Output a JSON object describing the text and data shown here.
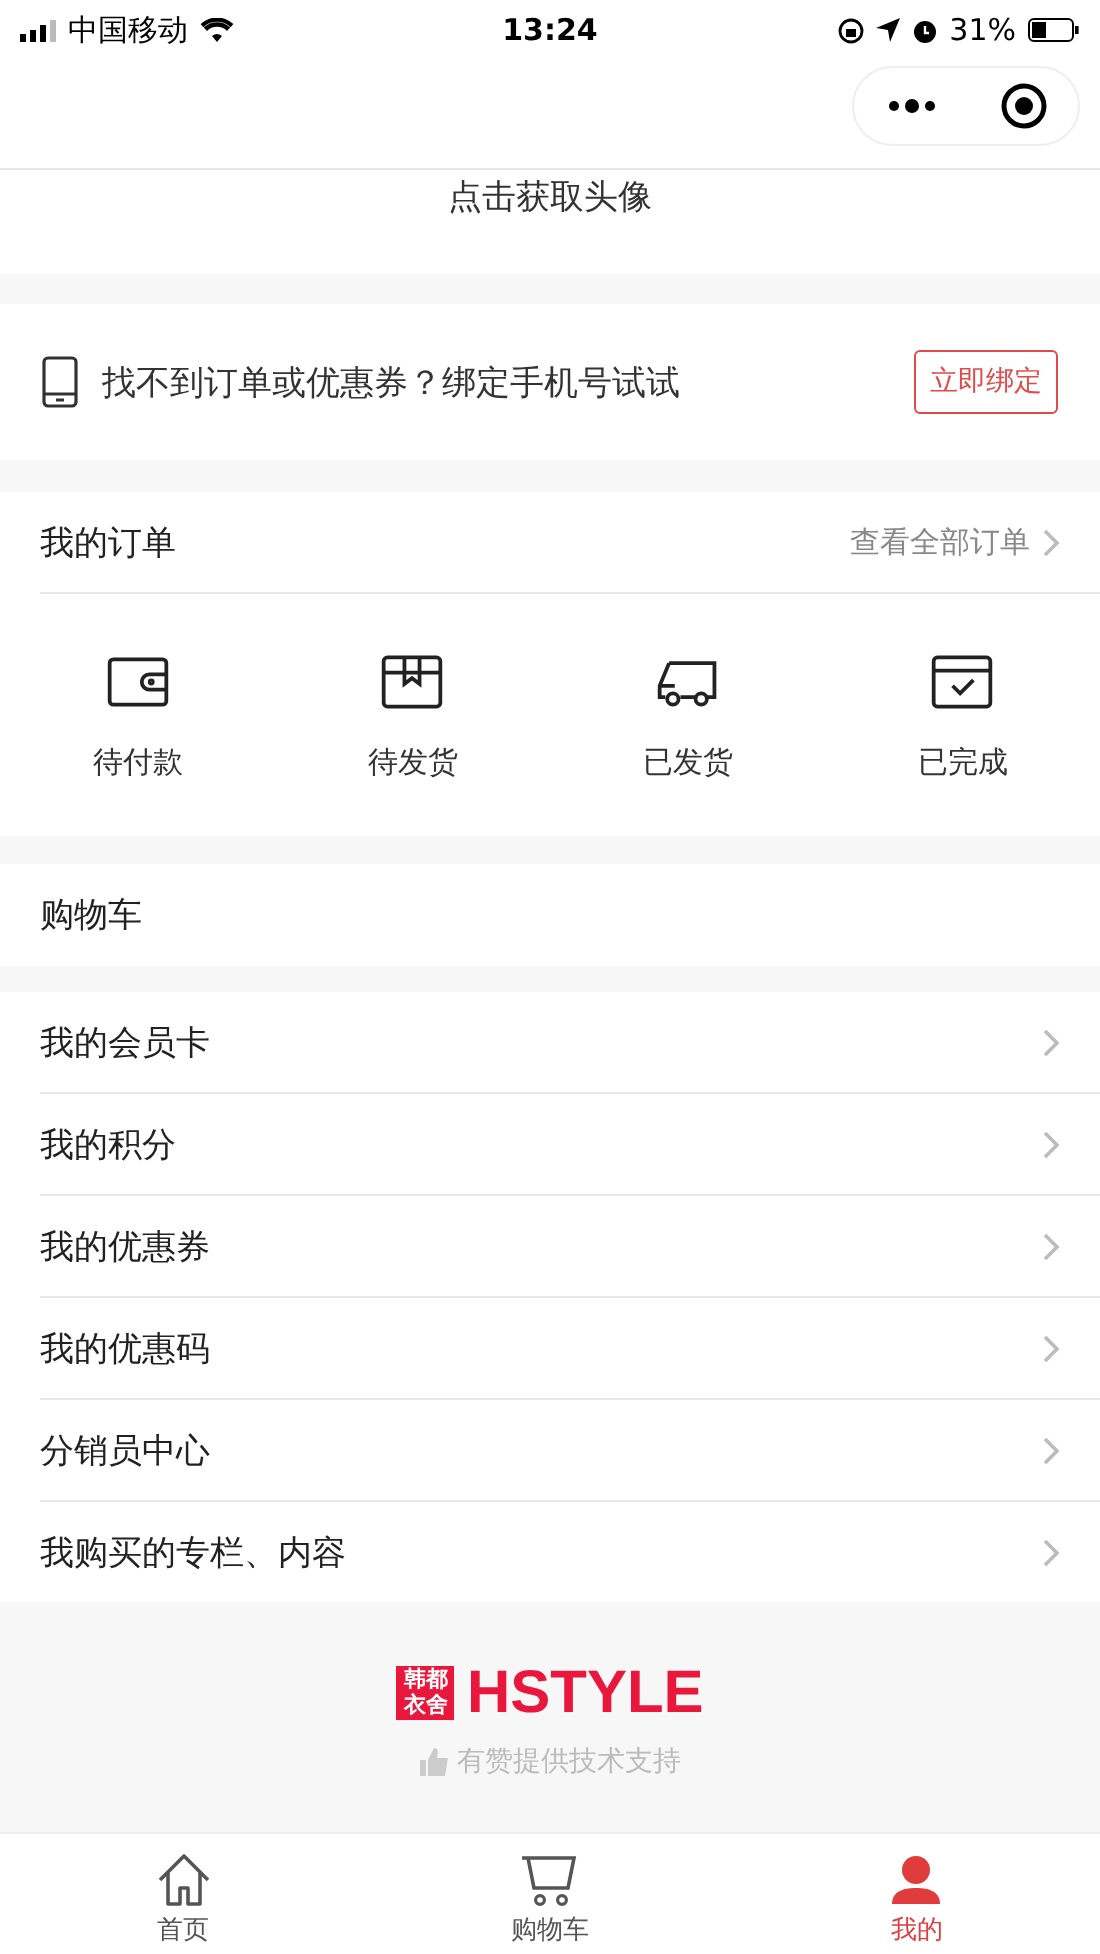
{
  "status_bar": {
    "carrier": "中国移动",
    "time": "13:24",
    "battery": "31%"
  },
  "avatar": {
    "prompt": "点击获取头像"
  },
  "bind_phone": {
    "message": "找不到订单或优惠券？绑定手机号试试",
    "button": "立即绑定"
  },
  "orders": {
    "title": "我的订单",
    "view_all": "查看全部订单",
    "items": [
      {
        "label": "待付款"
      },
      {
        "label": "待发货"
      },
      {
        "label": "已发货"
      },
      {
        "label": "已完成"
      }
    ]
  },
  "cart": {
    "title": "购物车"
  },
  "menu": [
    {
      "label": "我的会员卡"
    },
    {
      "label": "我的积分"
    },
    {
      "label": "我的优惠券"
    },
    {
      "label": "我的优惠码"
    },
    {
      "label": "分销员中心"
    },
    {
      "label": "我购买的专栏、内容"
    }
  ],
  "footer": {
    "logo_mark": "韩都衣舍",
    "logo_text": "HSTYLE",
    "support": "有赞提供技术支持"
  },
  "tabs": [
    {
      "label": "首页",
      "selected": false
    },
    {
      "label": "购物车",
      "selected": false
    },
    {
      "label": "我的",
      "selected": true
    }
  ]
}
